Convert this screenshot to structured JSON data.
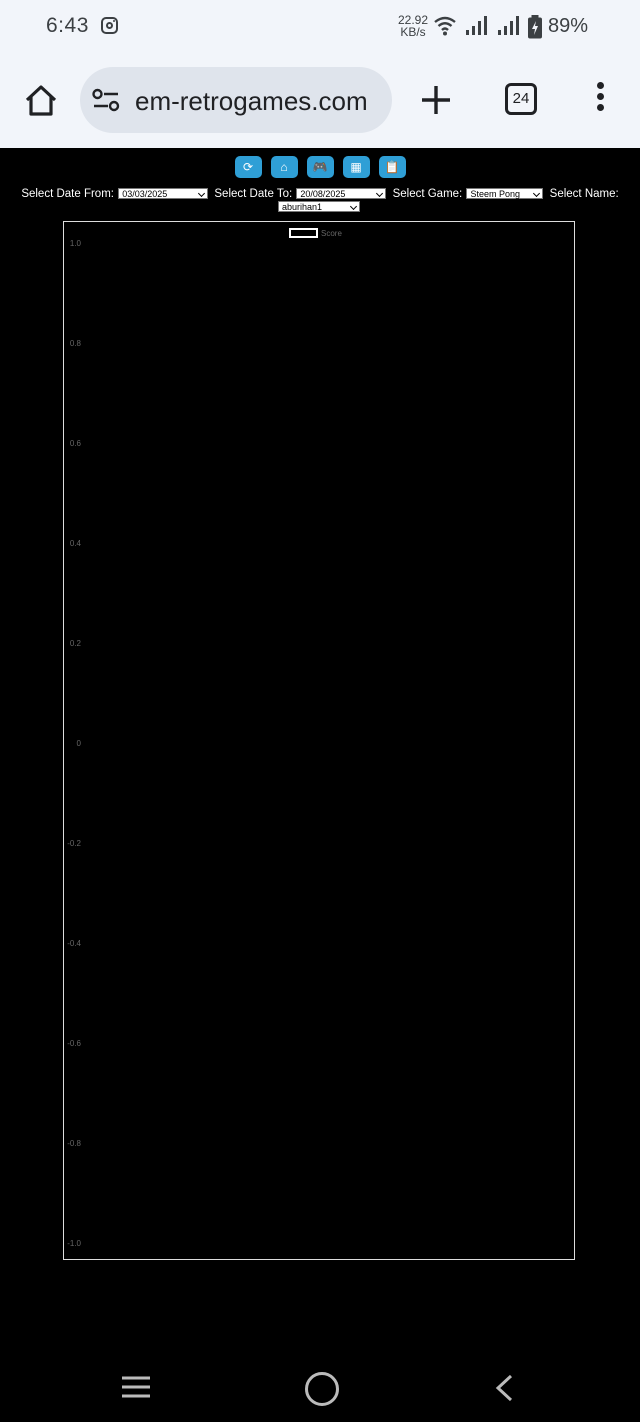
{
  "status_bar": {
    "time": "6:43",
    "net_speed_value": "22.92",
    "net_speed_unit": "KB/s",
    "battery": "89%",
    "icons": [
      "instagram-icon",
      "wifi-icon",
      "signal-icon",
      "signal-icon",
      "battery-charging-icon"
    ]
  },
  "browser": {
    "url": "em-retrogames.com",
    "tab_count": "24",
    "icons": [
      "home-icon",
      "site-settings-icon",
      "plus-icon",
      "tabs-icon",
      "more-vert-icon"
    ]
  },
  "page": {
    "nav_buttons": [
      {
        "name": "refresh-icon",
        "glyph": "⟳"
      },
      {
        "name": "home-icon",
        "glyph": "⌂"
      },
      {
        "name": "gamepad-icon",
        "glyph": "🎮"
      },
      {
        "name": "grid-icon",
        "glyph": "▦"
      },
      {
        "name": "clipboard-icon",
        "glyph": "📋"
      }
    ],
    "filters": {
      "date_from_label": "Select Date From:",
      "date_from_value": "03/03/2025",
      "date_to_label": "Select Date To:",
      "date_to_value": "20/08/2025",
      "game_label": "Select Game:",
      "game_value": "Steem Pong",
      "name_label": "Select Name:",
      "name_value": "aburihan1"
    }
  },
  "chart_data": {
    "type": "line",
    "title": "",
    "xlabel": "",
    "ylabel": "",
    "legend_placement": "top-center",
    "series": [
      {
        "name": "Score",
        "values": []
      }
    ],
    "ylim": [
      -1.0,
      1.0
    ],
    "yticks": [
      "1.0",
      "0.8",
      "0.6",
      "0.4",
      "0.2",
      "0",
      "-0.2",
      "-0.4",
      "-0.6",
      "-0.8",
      "-1.0"
    ],
    "grid": false
  }
}
